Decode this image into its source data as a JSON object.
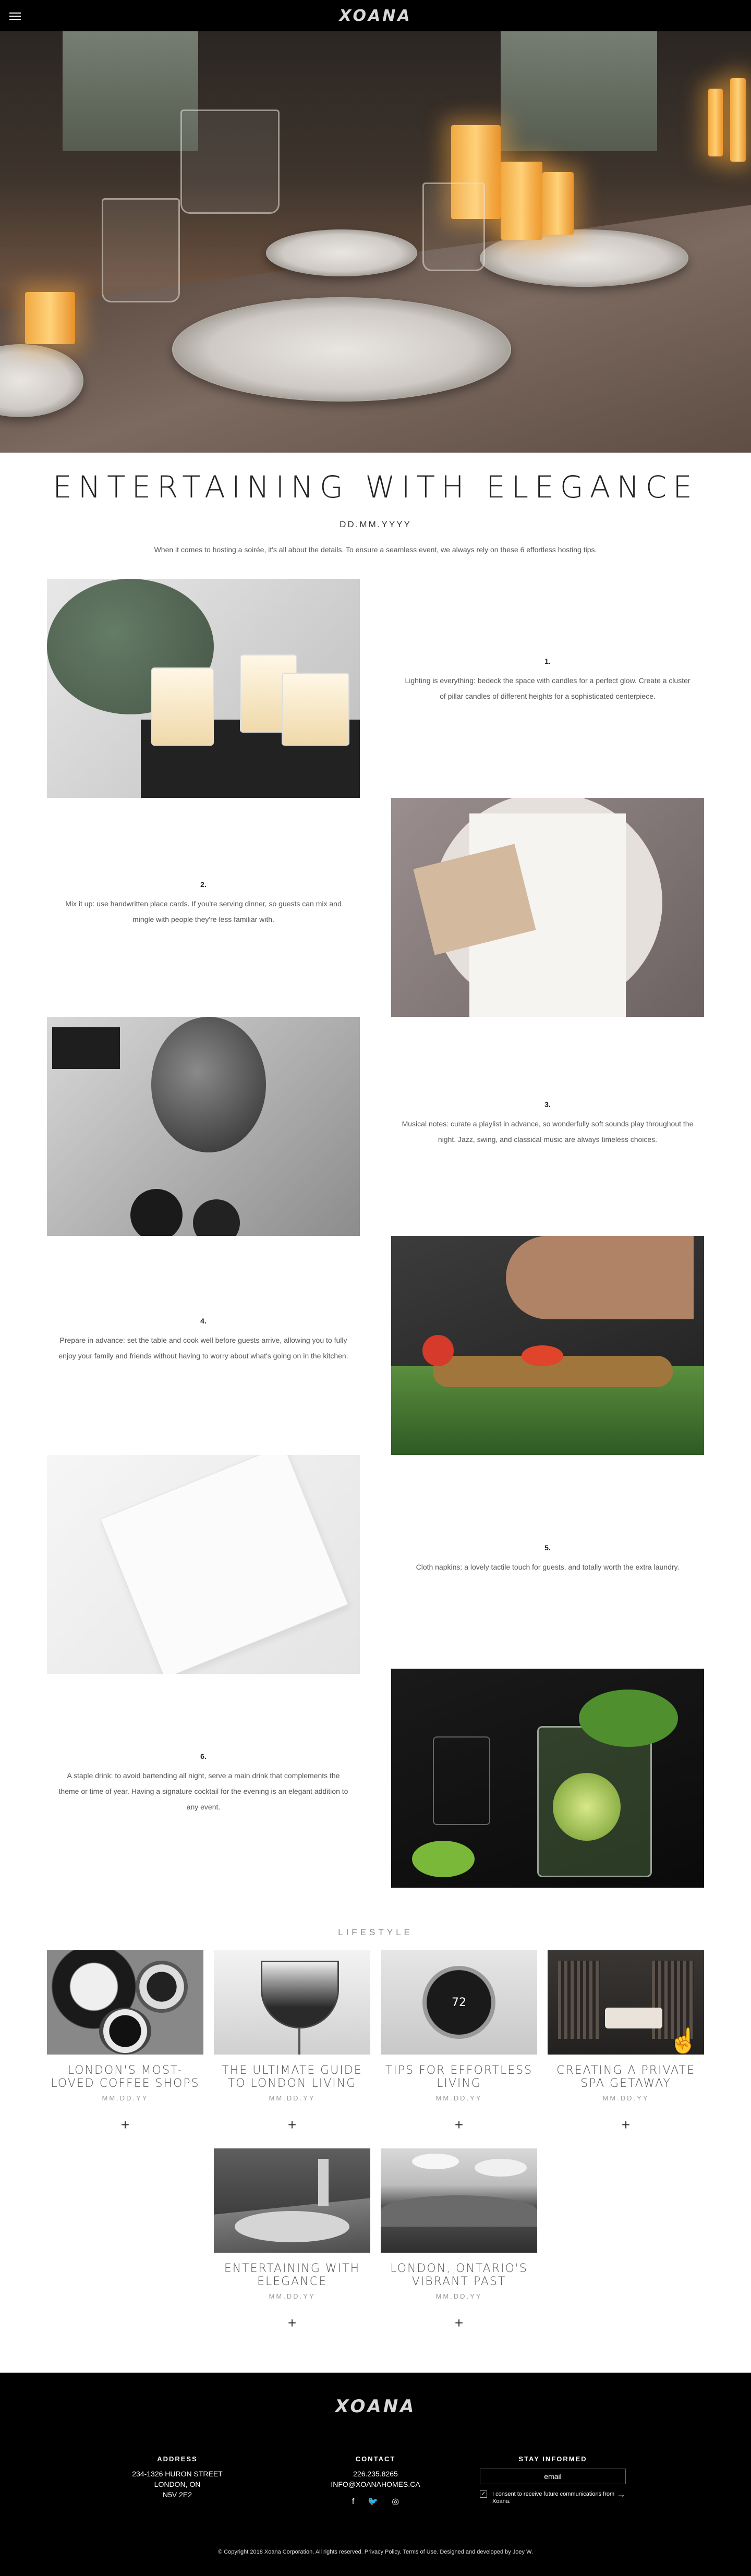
{
  "header": {
    "logo_text": "XOANA",
    "menu_icon": "hamburger-menu-icon"
  },
  "article": {
    "title": "ENTERTAINING WITH ELEGANCE",
    "date": "DD.MM.YYYY",
    "intro": "When it comes to hosting a soirée, it's all about the details. To ensure a seamless event, we always rely on these 6 effortless hosting tips."
  },
  "tips": [
    {
      "num": "1.",
      "text": "Lighting is everything: bedeck the space with candles for a perfect glow. Create a cluster of pillar candles of different heights for a sophisticated centerpiece."
    },
    {
      "num": "2.",
      "text": "Mix it up: use handwritten place cards. If you're serving dinner, so guests can mix and mingle with people they're less familiar with."
    },
    {
      "num": "3.",
      "text": "Musical notes: curate a playlist in advance, so wonderfully soft sounds play throughout the night. Jazz, swing, and classical music are always timeless choices."
    },
    {
      "num": "4.",
      "text": "Prepare in advance: set the table and cook well before guests arrive, allowing you to fully enjoy your family and friends without having to worry about what's going on in the kitchen."
    },
    {
      "num": "5.",
      "text": "Cloth napkins: a lovely tactile touch for guests, and totally worth the extra laundry."
    },
    {
      "num": "6.",
      "text": "A staple drink: to avoid bartending all night, serve a main drink that complements the theme or time of year. Having a signature cocktail for the evening is an elegant addition to any event."
    }
  ],
  "lifestyle": {
    "label": "LIFESTYLE",
    "cards": [
      {
        "title": "LONDON'S MOST-LOVED COFFEE SHOPS",
        "date": "MM.DD.YY",
        "plus": "+"
      },
      {
        "title": "THE ULTIMATE GUIDE TO LONDON LIVING",
        "date": "MM.DD.YY",
        "plus": "+"
      },
      {
        "title": "TIPS FOR EFFORTLESS LIVING",
        "date": "MM.DD.YY",
        "plus": "+",
        "thermostat_value": "72"
      },
      {
        "title": "CREATING A PRIVATE SPA GETAWAY",
        "date": "MM.DD.YY",
        "plus": "+"
      },
      {
        "title": "ENTERTAINING WITH ELEGANCE",
        "date": "MM.DD.YY",
        "plus": "+"
      },
      {
        "title": "LONDON, ONTARIO'S VIBRANT PAST",
        "date": "MM.DD.YY",
        "plus": "+"
      }
    ]
  },
  "footer": {
    "logo_text": "XOANA",
    "address_head": "ADDRESS",
    "address_lines": [
      "234-1326 HURON STREET",
      "LONDON, ON",
      "N5V 2E2"
    ],
    "contact_head": "CONTACT",
    "phone": "226.235.8265",
    "email": "INFO@XOANAHOMES.CA",
    "social_icons": [
      "facebook-icon",
      "twitter-icon",
      "instagram-icon"
    ],
    "stay_head": "STAY INFORMED",
    "email_placeholder": "email",
    "consent": "I consent to receive future communications from Xoana.",
    "submit_arrow": "→",
    "copyright": "© Copyright 2018 Xoana Corporation. All rights reserved. Privacy Policy. Terms of Use. Designed and developed by Joey W."
  }
}
